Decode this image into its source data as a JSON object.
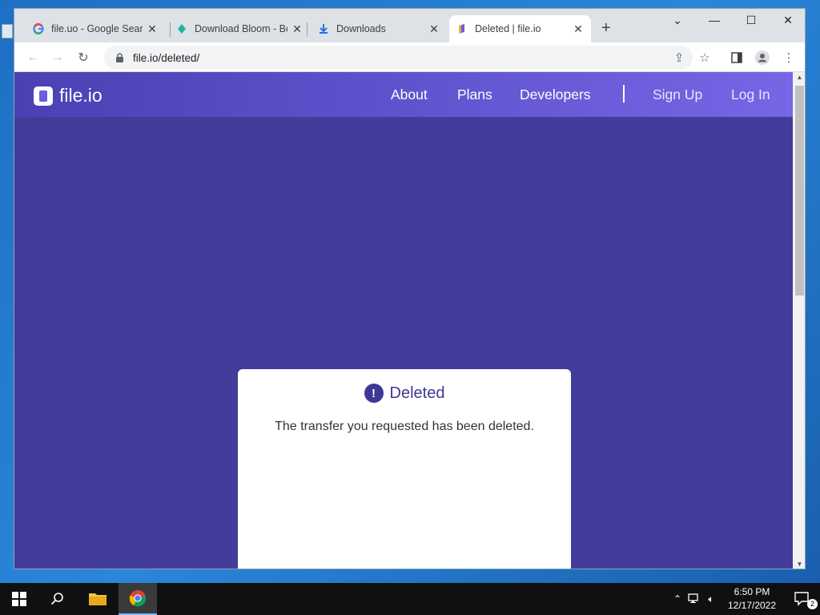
{
  "browser": {
    "tabs": [
      {
        "title": "file.uo - Google Search",
        "favicon": "google-icon"
      },
      {
        "title": "Download Bloom - Bo",
        "favicon": "bloom-icon"
      },
      {
        "title": "Downloads",
        "favicon": "download-icon"
      },
      {
        "title": "Deleted | file.io",
        "favicon": "fileio-icon",
        "active": true
      }
    ],
    "address": "file.io/deleted/"
  },
  "site": {
    "logo_text": "file.io",
    "nav": {
      "about": "About",
      "plans": "Plans",
      "developers": "Developers",
      "signup": "Sign Up",
      "login": "Log In"
    }
  },
  "card": {
    "icon": "!",
    "title": "Deleted",
    "message": "The transfer you requested has been deleted."
  },
  "taskbar": {
    "time": "6:50 PM",
    "date": "12/17/2022",
    "notification_count": "2"
  },
  "colors": {
    "page_bg": "#433c9b",
    "header_start": "#4a41b3",
    "header_end": "#7766e6",
    "accent": "#3e3797"
  }
}
